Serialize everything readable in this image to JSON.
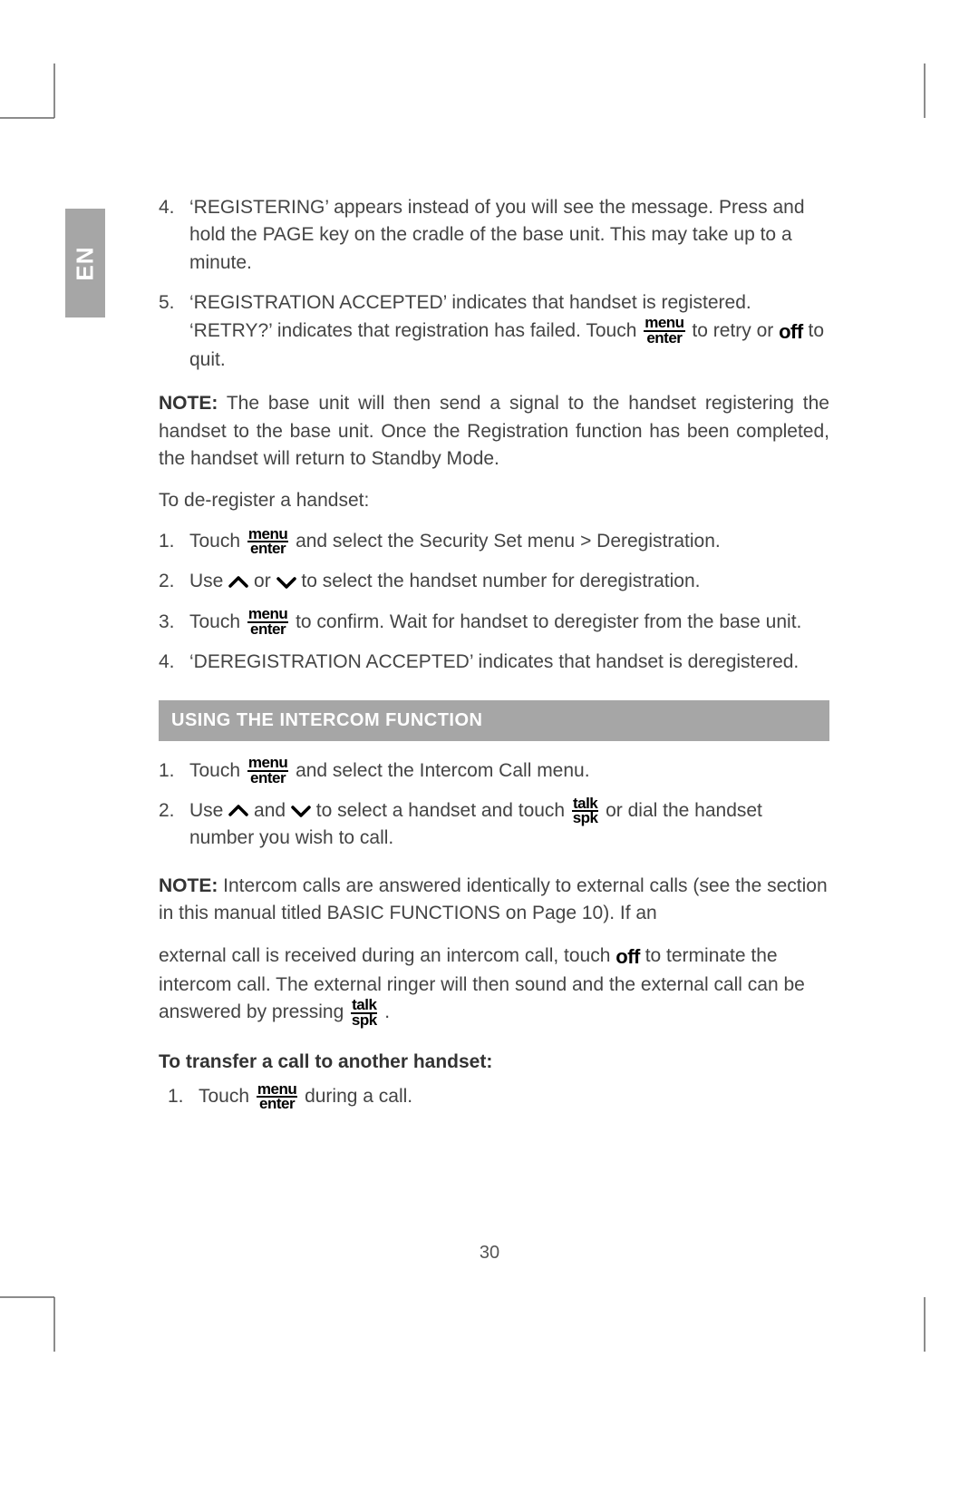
{
  "lang_tab": "EN",
  "list_a": [
    {
      "num": "4.",
      "text": "‘REGISTERING’ appears instead of you will see the message.  Press and hold the PAGE key on the cradle of the base unit. This may take up to a minute."
    },
    {
      "num": "5.",
      "pre": "‘REGISTRATION ACCEPTED’ indicates that handset is registered.  ‘RETRY?’ indicates that registration has failed.  Touch ",
      "mid": " to retry or ",
      "post": " to quit."
    }
  ],
  "note1_label": "NOTE:",
  "note1_text": " The base unit will then send a signal to the handset registering the handset to the base unit.  Once the Registration function has been completed, the handset will return to Standby Mode.",
  "dereg_lead": "To de-register a handset:",
  "list_b": [
    {
      "num": "1.",
      "pre": "Touch ",
      "post": " and select the Security Set menu > Deregistration."
    },
    {
      "num": "2.",
      "pre": "Use ",
      "mid": " or ",
      "post": " to select the handset number for deregistration."
    },
    {
      "num": "3.",
      "pre": "Touch ",
      "post": " to confirm.  Wait for handset to deregister from the base unit."
    },
    {
      "num": "4.",
      "text": "‘DEREGISTRATION ACCEPTED’ indicates that handset is deregistered."
    }
  ],
  "section_title": "USING THE INTERCOM FUNCTION",
  "list_c": [
    {
      "num": "1.",
      "pre": "Touch ",
      "post": " and select the Intercom Call menu."
    },
    {
      "num": "2.",
      "pre": "Use ",
      "mid1": " and ",
      "mid2": " to select a handset and touch ",
      "post": " or dial the handset number you wish to call."
    }
  ],
  "note2_label": "NOTE:",
  "note2_text": " Intercom calls are answered identically to external calls (see the section in this manual titled BASIC FUNCTIONS on Page 10).  If an",
  "note2_cont_pre": "external call is received during an intercom call, touch ",
  "note2_cont_mid": " to terminate the intercom call.  The external ringer will then sound and the external call can be answered by pressing ",
  "note2_cont_post": " .",
  "transfer_head": "To transfer a call to another handset:",
  "transfer_item": {
    "num": "1.",
    "pre": "Touch ",
    "post": " during a call."
  },
  "icons": {
    "menu_top": "menu",
    "menu_bot": "enter",
    "talk_top": "talk",
    "talk_bot": "spk",
    "off": "off"
  },
  "page_number": "30"
}
